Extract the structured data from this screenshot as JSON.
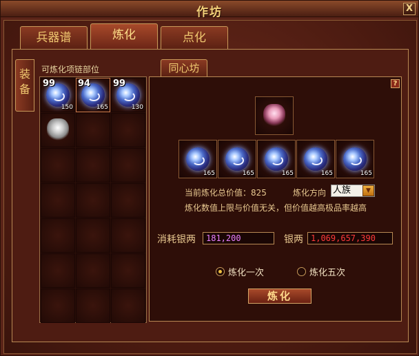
{
  "window": {
    "title": "作坊",
    "close_label": "X"
  },
  "tabs": [
    {
      "label": "兵器谱",
      "active": false
    },
    {
      "label": "炼化",
      "active": true
    },
    {
      "label": "点化",
      "active": false
    }
  ],
  "side_tab": {
    "label": "装备"
  },
  "sub_tab": {
    "label": "同心坊"
  },
  "inventory": {
    "label": "可炼化项链部位",
    "items": [
      {
        "type": "orb",
        "top_count": "99",
        "bottom_value": "150"
      },
      {
        "type": "orb",
        "top_count": "94",
        "bottom_value": "165"
      },
      {
        "type": "orb",
        "top_count": "99",
        "bottom_value": "130"
      },
      {
        "type": "necklace-white"
      }
    ]
  },
  "refine": {
    "help_label": "?",
    "target_item": {
      "type": "necklace-pink"
    },
    "material_slots": [
      {
        "value": "165"
      },
      {
        "value": "165"
      },
      {
        "value": "165"
      },
      {
        "value": "165"
      },
      {
        "value": "165"
      }
    ],
    "total_value_label": "当前炼化总价值：825",
    "direction_label": "炼化方向",
    "direction_value": "人族",
    "note": "炼化数值上限与价值无关，但价值越高极品率越高",
    "cost_label": "消耗银两",
    "cost_value": "181,200",
    "silver_label": "银两",
    "silver_value": "1,069,657,390",
    "option_once": "炼化一次",
    "option_five": "炼化五次",
    "selected_option": "once",
    "action_label": "炼化"
  },
  "colors": {
    "cost_value": "#e880ff",
    "silver_value": "#ff3a3a",
    "accent_gold": "#f0c870"
  }
}
